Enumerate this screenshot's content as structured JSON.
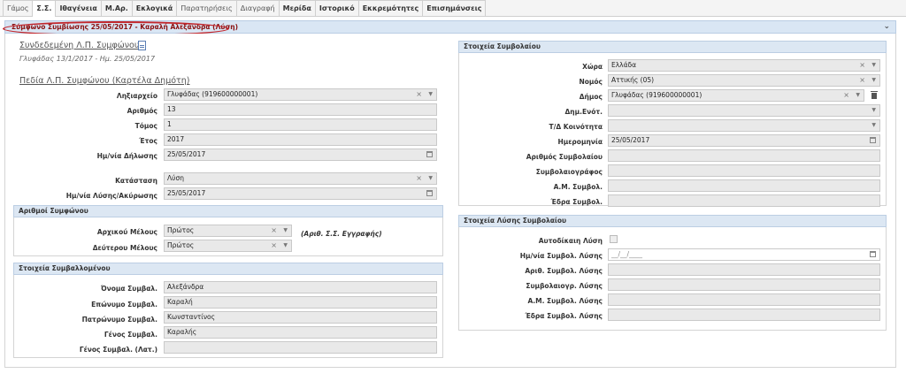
{
  "tabs": [
    {
      "label": "Γάμος",
      "light": true
    },
    {
      "label": "Σ.Σ.",
      "active": true
    },
    {
      "label": "Ιθαγένεια"
    },
    {
      "label": "Μ.Αρ."
    },
    {
      "label": "Εκλογικά"
    },
    {
      "label": "Παρατηρήσεις",
      "light": true
    },
    {
      "label": "Διαγραφή",
      "light": true
    },
    {
      "label": "Μερίδα"
    },
    {
      "label": "Ιστορικό"
    },
    {
      "label": "Εκκρεμότητες"
    },
    {
      "label": "Επισημάνσεις"
    }
  ],
  "panel": {
    "title": "Σύμφωνο Συμβίωσης 25/05/2017 - Καραλή Αλεξάνδρα (Λύση)",
    "chevron": "⌄"
  },
  "linked": {
    "link": "Συνδεδεμένη Λ.Π. Συμφώνου",
    "subtitle": "Γλυφάδας 13/1/2017 - Ημ. 25/05/2017",
    "fields_link": "Πεδία Λ.Π. Συμφώνου (Καρτέλα Δημότη)"
  },
  "left_fields": {
    "registry_label": "Ληξιαρχείο",
    "registry_value": "Γλυφάδας (919600000001)",
    "number_label": "Αριθμός",
    "number_value": "13",
    "volume_label": "Τόμος",
    "volume_value": "1",
    "year_label": "Έτος",
    "year_value": "2017",
    "declaration_date_label": "Ημ/νία Δήλωσης",
    "declaration_date_value": "25/05/2017",
    "status_label": "Κατάσταση",
    "status_value": "Λύση",
    "dissolution_date_label": "Ημ/νία Λύσης/Ακύρωσης",
    "dissolution_date_value": "25/05/2017"
  },
  "pact_numbers": {
    "header": "Αριθμοί Συμφώνου",
    "first_label": "Αρχικού Μέλους",
    "first_value": "Πρώτος",
    "second_label": "Δεύτερου Μέλους",
    "second_value": "Πρώτος",
    "note": "(Αριθ. Σ.Σ. Εγγραφής)"
  },
  "partner": {
    "header": "Στοιχεία Συμβαλλομένου",
    "name_label": "Όνομα Συμβαλ.",
    "name_value": "Αλεξάνδρα",
    "surname_label": "Επώνυμο Συμβαλ.",
    "surname_value": "Καραλή",
    "father_label": "Πατρώνυμο Συμβαλ.",
    "father_value": "Κωνσταντίνος",
    "gender_label": "Γένος Συμβαλ.",
    "gender_value": "Καραλής",
    "gender_lat_label": "Γένος Συμβαλ. (Λατ.)",
    "gender_lat_value": ""
  },
  "contract": {
    "header": "Στοιχεία Συμβολαίου",
    "country_label": "Χώρα",
    "country_value": "Ελλάδα",
    "prefecture_label": "Νομός",
    "prefecture_value": "Αττικής (05)",
    "municipality_label": "Δήμος",
    "municipality_value": "Γλυφάδας (919600000001)",
    "unit_label": "Δημ.Ενότ.",
    "unit_value": "",
    "community_label": "Τ/Δ Κοινότητα",
    "community_value": "",
    "date_label": "Ημερομηνία",
    "date_value": "25/05/2017",
    "contract_no_label": "Αριθμός Συμβολαίου",
    "contract_no_value": "",
    "notary_label": "Συμβολαιογράφος",
    "notary_value": "",
    "am_label": "Α.Μ. Συμβολ.",
    "am_value": "",
    "seat_label": "Έδρα Συμβολ.",
    "seat_value": ""
  },
  "dissolution": {
    "header": "Στοιχεία Λύσης Συμβολαίου",
    "auto_label": "Αυτοδίκαιη Λύση",
    "date_label": "Ημ/νία Συμβολ. Λύσης",
    "date_placeholder": "__/__/____",
    "no_label": "Αριθ. Συμβολ. Λύσης",
    "no_value": "",
    "notary_label": "Συμβολαιογρ. Λύσης",
    "notary_value": "",
    "am_label": "Α.Μ. Συμβολ. Λύσης",
    "am_value": "",
    "seat_label": "Έδρα Συμβολ. Λύσης",
    "seat_value": ""
  },
  "icons": {
    "calendar": "calendar-icon",
    "dropdown": "▼",
    "clear": "×",
    "trash": "trash-icon",
    "document": "document-icon"
  }
}
